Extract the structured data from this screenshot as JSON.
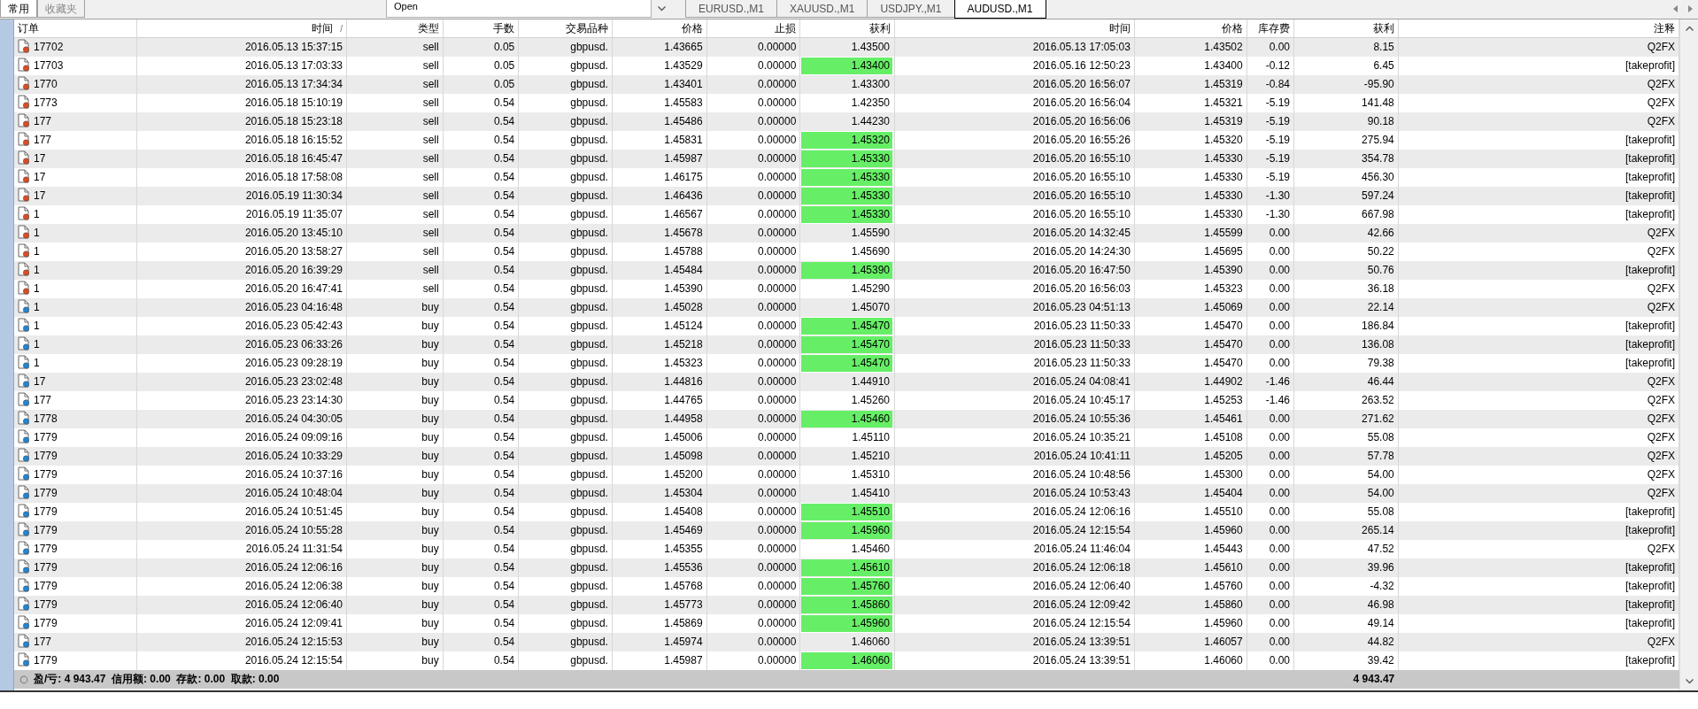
{
  "top_tabs": [
    {
      "label": "常用",
      "selected": true
    },
    {
      "label": "收藏夹",
      "selected": false
    }
  ],
  "list_box": {
    "items": [
      "Open"
    ]
  },
  "chart_tabs": [
    {
      "label": "EURUSD.,M1",
      "selected": false
    },
    {
      "label": "XAUUSD.,M1",
      "selected": false
    },
    {
      "label": "USDJPY.,M1",
      "selected": false
    },
    {
      "label": "AUDUSD.,M1",
      "selected": true
    }
  ],
  "table": {
    "columns": [
      "订单",
      "时间",
      "类型",
      "手数",
      "交易品种",
      "价格",
      "止损",
      "获利",
      "时间",
      "价格",
      "库存费",
      "获利",
      "注释"
    ],
    "sort_mark": "/",
    "rows": [
      {
        "kind": "sell",
        "highlighted": false,
        "cells": [
          "17702",
          "2016.05.13 15:37:15",
          "sell",
          "0.05",
          "gbpusd.",
          "1.43665",
          "0.00000",
          "1.43500",
          "2016.05.13 17:05:03",
          "1.43502",
          "0.00",
          "8.15",
          "Q2FX"
        ]
      },
      {
        "kind": "sell",
        "highlighted": true,
        "cells": [
          "17703",
          "2016.05.13 17:03:33",
          "sell",
          "0.05",
          "gbpusd.",
          "1.43529",
          "0.00000",
          "1.43400",
          "2016.05.16 12:50:23",
          "1.43400",
          "-0.12",
          "6.45",
          "[takeprofit]"
        ]
      },
      {
        "kind": "sell",
        "highlighted": false,
        "cells": [
          "1770",
          "2016.05.13 17:34:34",
          "sell",
          "0.05",
          "gbpusd.",
          "1.43401",
          "0.00000",
          "1.43300",
          "2016.05.20 16:56:07",
          "1.45319",
          "-0.84",
          "-95.90",
          "Q2FX"
        ]
      },
      {
        "kind": "sell",
        "highlighted": false,
        "cells": [
          "1773",
          "2016.05.18 15:10:19",
          "sell",
          "0.54",
          "gbpusd.",
          "1.45583",
          "0.00000",
          "1.42350",
          "2016.05.20 16:56:04",
          "1.45321",
          "-5.19",
          "141.48",
          "Q2FX"
        ]
      },
      {
        "kind": "sell",
        "highlighted": false,
        "cells": [
          "177",
          "2016.05.18 15:23:18",
          "sell",
          "0.54",
          "gbpusd.",
          "1.45486",
          "0.00000",
          "1.44230",
          "2016.05.20 16:56:06",
          "1.45319",
          "-5.19",
          "90.18",
          "Q2FX"
        ]
      },
      {
        "kind": "sell",
        "highlighted": true,
        "cells": [
          "177",
          "2016.05.18 16:15:52",
          "sell",
          "0.54",
          "gbpusd.",
          "1.45831",
          "0.00000",
          "1.45320",
          "2016.05.20 16:55:26",
          "1.45320",
          "-5.19",
          "275.94",
          "[takeprofit]"
        ]
      },
      {
        "kind": "sell",
        "highlighted": true,
        "cells": [
          "17",
          "2016.05.18 16:45:47",
          "sell",
          "0.54",
          "gbpusd.",
          "1.45987",
          "0.00000",
          "1.45330",
          "2016.05.20 16:55:10",
          "1.45330",
          "-5.19",
          "354.78",
          "[takeprofit]"
        ]
      },
      {
        "kind": "sell",
        "highlighted": true,
        "cells": [
          "17",
          "2016.05.18 17:58:08",
          "sell",
          "0.54",
          "gbpusd.",
          "1.46175",
          "0.00000",
          "1.45330",
          "2016.05.20 16:55:10",
          "1.45330",
          "-5.19",
          "456.30",
          "[takeprofit]"
        ]
      },
      {
        "kind": "sell",
        "highlighted": true,
        "cells": [
          "17",
          "2016.05.19 11:30:34",
          "sell",
          "0.54",
          "gbpusd.",
          "1.46436",
          "0.00000",
          "1.45330",
          "2016.05.20 16:55:10",
          "1.45330",
          "-1.30",
          "597.24",
          "[takeprofit]"
        ]
      },
      {
        "kind": "sell",
        "highlighted": true,
        "cells": [
          "1",
          "2016.05.19 11:35:07",
          "sell",
          "0.54",
          "gbpusd.",
          "1.46567",
          "0.00000",
          "1.45330",
          "2016.05.20 16:55:10",
          "1.45330",
          "-1.30",
          "667.98",
          "[takeprofit]"
        ]
      },
      {
        "kind": "sell",
        "highlighted": false,
        "cells": [
          "1",
          "2016.05.20 13:45:10",
          "sell",
          "0.54",
          "gbpusd.",
          "1.45678",
          "0.00000",
          "1.45590",
          "2016.05.20 14:32:45",
          "1.45599",
          "0.00",
          "42.66",
          "Q2FX"
        ]
      },
      {
        "kind": "sell",
        "highlighted": false,
        "cells": [
          "1",
          "2016.05.20 13:58:27",
          "sell",
          "0.54",
          "gbpusd.",
          "1.45788",
          "0.00000",
          "1.45690",
          "2016.05.20 14:24:30",
          "1.45695",
          "0.00",
          "50.22",
          "Q2FX"
        ]
      },
      {
        "kind": "sell",
        "highlighted": true,
        "cells": [
          "1",
          "2016.05.20 16:39:29",
          "sell",
          "0.54",
          "gbpusd.",
          "1.45484",
          "0.00000",
          "1.45390",
          "2016.05.20 16:47:50",
          "1.45390",
          "0.00",
          "50.76",
          "[takeprofit]"
        ]
      },
      {
        "kind": "sell",
        "highlighted": false,
        "cells": [
          "1",
          "2016.05.20 16:47:41",
          "sell",
          "0.54",
          "gbpusd.",
          "1.45390",
          "0.00000",
          "1.45290",
          "2016.05.20 16:56:03",
          "1.45323",
          "0.00",
          "36.18",
          "Q2FX"
        ]
      },
      {
        "kind": "buy",
        "highlighted": false,
        "cells": [
          "1",
          "2016.05.23 04:16:48",
          "buy",
          "0.54",
          "gbpusd.",
          "1.45028",
          "0.00000",
          "1.45070",
          "2016.05.23 04:51:13",
          "1.45069",
          "0.00",
          "22.14",
          "Q2FX"
        ]
      },
      {
        "kind": "buy",
        "highlighted": true,
        "cells": [
          "1",
          "2016.05.23 05:42:43",
          "buy",
          "0.54",
          "gbpusd.",
          "1.45124",
          "0.00000",
          "1.45470",
          "2016.05.23 11:50:33",
          "1.45470",
          "0.00",
          "186.84",
          "[takeprofit]"
        ]
      },
      {
        "kind": "buy",
        "highlighted": true,
        "cells": [
          "1",
          "2016.05.23 06:33:26",
          "buy",
          "0.54",
          "gbpusd.",
          "1.45218",
          "0.00000",
          "1.45470",
          "2016.05.23 11:50:33",
          "1.45470",
          "0.00",
          "136.08",
          "[takeprofit]"
        ]
      },
      {
        "kind": "buy",
        "highlighted": true,
        "cells": [
          "1",
          "2016.05.23 09:28:19",
          "buy",
          "0.54",
          "gbpusd.",
          "1.45323",
          "0.00000",
          "1.45470",
          "2016.05.23 11:50:33",
          "1.45470",
          "0.00",
          "79.38",
          "[takeprofit]"
        ]
      },
      {
        "kind": "buy",
        "highlighted": false,
        "cells": [
          "17",
          "2016.05.23 23:02:48",
          "buy",
          "0.54",
          "gbpusd.",
          "1.44816",
          "0.00000",
          "1.44910",
          "2016.05.24 04:08:41",
          "1.44902",
          "-1.46",
          "46.44",
          "Q2FX"
        ]
      },
      {
        "kind": "buy",
        "highlighted": false,
        "cells": [
          "177",
          "2016.05.23 23:14:30",
          "buy",
          "0.54",
          "gbpusd.",
          "1.44765",
          "0.00000",
          "1.45260",
          "2016.05.24 10:45:17",
          "1.45253",
          "-1.46",
          "263.52",
          "Q2FX"
        ]
      },
      {
        "kind": "buy",
        "highlighted": true,
        "cells": [
          "1778",
          "2016.05.24 04:30:05",
          "buy",
          "0.54",
          "gbpusd.",
          "1.44958",
          "0.00000",
          "1.45460",
          "2016.05.24 10:55:36",
          "1.45461",
          "0.00",
          "271.62",
          "Q2FX"
        ]
      },
      {
        "kind": "buy",
        "highlighted": false,
        "cells": [
          "1779",
          "2016.05.24 09:09:16",
          "buy",
          "0.54",
          "gbpusd.",
          "1.45006",
          "0.00000",
          "1.45110",
          "2016.05.24 10:35:21",
          "1.45108",
          "0.00",
          "55.08",
          "Q2FX"
        ]
      },
      {
        "kind": "buy",
        "highlighted": false,
        "cells": [
          "1779",
          "2016.05.24 10:33:29",
          "buy",
          "0.54",
          "gbpusd.",
          "1.45098",
          "0.00000",
          "1.45210",
          "2016.05.24 10:41:11",
          "1.45205",
          "0.00",
          "57.78",
          "Q2FX"
        ]
      },
      {
        "kind": "buy",
        "highlighted": false,
        "cells": [
          "1779",
          "2016.05.24 10:37:16",
          "buy",
          "0.54",
          "gbpusd.",
          "1.45200",
          "0.00000",
          "1.45310",
          "2016.05.24 10:48:56",
          "1.45300",
          "0.00",
          "54.00",
          "Q2FX"
        ]
      },
      {
        "kind": "buy",
        "highlighted": false,
        "cells": [
          "1779",
          "2016.05.24 10:48:04",
          "buy",
          "0.54",
          "gbpusd.",
          "1.45304",
          "0.00000",
          "1.45410",
          "2016.05.24 10:53:43",
          "1.45404",
          "0.00",
          "54.00",
          "Q2FX"
        ]
      },
      {
        "kind": "buy",
        "highlighted": true,
        "cells": [
          "1779",
          "2016.05.24 10:51:45",
          "buy",
          "0.54",
          "gbpusd.",
          "1.45408",
          "0.00000",
          "1.45510",
          "2016.05.24 12:06:16",
          "1.45510",
          "0.00",
          "55.08",
          "[takeprofit]"
        ]
      },
      {
        "kind": "buy",
        "highlighted": true,
        "cells": [
          "1779",
          "2016.05.24 10:55:28",
          "buy",
          "0.54",
          "gbpusd.",
          "1.45469",
          "0.00000",
          "1.45960",
          "2016.05.24 12:15:54",
          "1.45960",
          "0.00",
          "265.14",
          "[takeprofit]"
        ]
      },
      {
        "kind": "buy",
        "highlighted": false,
        "cells": [
          "1779",
          "2016.05.24 11:31:54",
          "buy",
          "0.54",
          "gbpusd.",
          "1.45355",
          "0.00000",
          "1.45460",
          "2016.05.24 11:46:04",
          "1.45443",
          "0.00",
          "47.52",
          "Q2FX"
        ]
      },
      {
        "kind": "buy",
        "highlighted": true,
        "cells": [
          "1779",
          "2016.05.24 12:06:16",
          "buy",
          "0.54",
          "gbpusd.",
          "1.45536",
          "0.00000",
          "1.45610",
          "2016.05.24 12:06:18",
          "1.45610",
          "0.00",
          "39.96",
          "[takeprofit]"
        ]
      },
      {
        "kind": "buy",
        "highlighted": true,
        "cells": [
          "1779",
          "2016.05.24 12:06:38",
          "buy",
          "0.54",
          "gbpusd.",
          "1.45768",
          "0.00000",
          "1.45760",
          "2016.05.24 12:06:40",
          "1.45760",
          "0.00",
          "-4.32",
          "[takeprofit]"
        ]
      },
      {
        "kind": "buy",
        "highlighted": true,
        "cells": [
          "1779",
          "2016.05.24 12:06:40",
          "buy",
          "0.54",
          "gbpusd.",
          "1.45773",
          "0.00000",
          "1.45860",
          "2016.05.24 12:09:42",
          "1.45860",
          "0.00",
          "46.98",
          "[takeprofit]"
        ]
      },
      {
        "kind": "buy",
        "highlighted": true,
        "cells": [
          "1779",
          "2016.05.24 12:09:41",
          "buy",
          "0.54",
          "gbpusd.",
          "1.45869",
          "0.00000",
          "1.45960",
          "2016.05.24 12:15:54",
          "1.45960",
          "0.00",
          "49.14",
          "[takeprofit]"
        ]
      },
      {
        "kind": "buy",
        "highlighted": false,
        "cells": [
          "177",
          "2016.05.24 12:15:53",
          "buy",
          "0.54",
          "gbpusd.",
          "1.45974",
          "0.00000",
          "1.46060",
          "2016.05.24 13:39:51",
          "1.46057",
          "0.00",
          "44.82",
          "Q2FX"
        ]
      },
      {
        "kind": "buy",
        "highlighted": true,
        "cells": [
          "1779",
          "2016.05.24 12:15:54",
          "buy",
          "0.54",
          "gbpusd.",
          "1.45987",
          "0.00000",
          "1.46060",
          "2016.05.24 13:39:51",
          "1.46060",
          "0.00",
          "39.42",
          "[takeprofit]"
        ]
      }
    ],
    "summary": {
      "text": "盈/亏: 4 943.47  信用额: 0.00  存款: 0.00  取款: 0.00",
      "total": "4 943.47"
    }
  }
}
